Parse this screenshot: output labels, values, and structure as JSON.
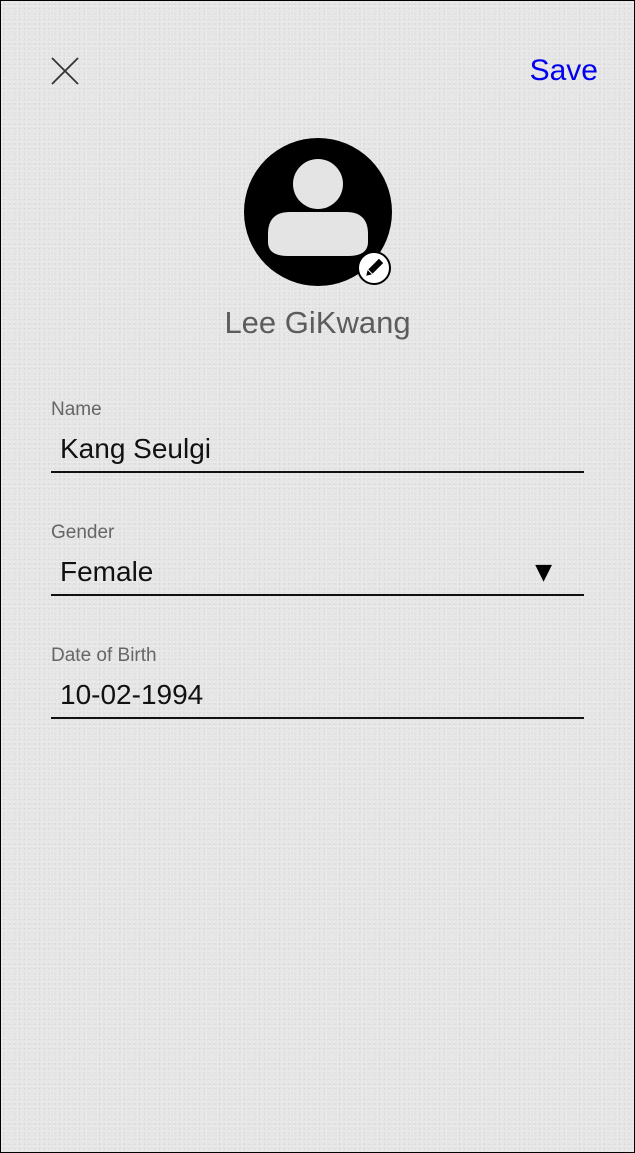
{
  "header": {
    "close_icon": "close-icon",
    "save_label": "Save",
    "save_color": "#0000ee"
  },
  "profile": {
    "avatar_icon": "account-circle-icon",
    "edit_icon": "pencil-icon",
    "display_name": "Lee GiKwang"
  },
  "form": {
    "name": {
      "label": "Name",
      "value": "Kang Seulgi"
    },
    "gender": {
      "label": "Gender",
      "value": "Female",
      "arrow_icon": "dropdown-arrow-icon",
      "arrow_glyph": "▼"
    },
    "dob": {
      "label": "Date of Birth",
      "value": "10-02-1994"
    }
  }
}
